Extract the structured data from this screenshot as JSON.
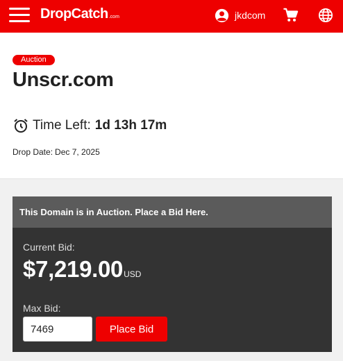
{
  "header": {
    "logo_text": "DropCatch",
    "logo_suffix": ".com",
    "username": "jkdcom",
    "brand_color": "#ee0000",
    "icons": [
      "menu-icon",
      "user-icon",
      "cart-icon",
      "globe-icon"
    ]
  },
  "domain": {
    "badge": "Auction",
    "name": "Unscr.com",
    "time_left_label": "Time Left:",
    "time_left_value": "1d 13h 17m",
    "drop_date_label": "Drop Date:",
    "drop_date_value": "Dec 7, 2025"
  },
  "bid": {
    "header": "This Domain is in Auction. Place a Bid Here.",
    "current_label": "Current Bid:",
    "current_amount": "$7,219.00",
    "currency": "USD",
    "max_label": "Max Bid:",
    "max_value": "7469",
    "place_button": "Place Bid"
  }
}
